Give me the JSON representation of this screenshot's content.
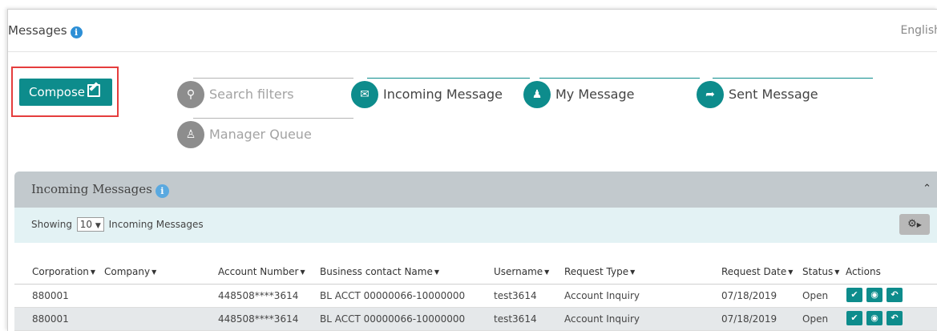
{
  "topbar": {
    "title": "Messages",
    "info_icon": "info-icon",
    "language": "English"
  },
  "compose": {
    "label": "Compose",
    "icon": "edit-icon"
  },
  "filters": {
    "search": {
      "label": "Search filters",
      "icon": "search-icon"
    },
    "incoming": {
      "label": "Incoming Message",
      "icon": "envelope-icon"
    },
    "my": {
      "label": "My Message",
      "icon": "user-arrow-icon"
    },
    "sent": {
      "label": "Sent Message",
      "icon": "share-icon"
    },
    "manager": {
      "label": "Manager Queue",
      "icon": "manager-icon"
    }
  },
  "panel": {
    "title": "Incoming Messages",
    "showing_prefix": "Showing",
    "page_size": "10",
    "showing_suffix": "Incoming Messages",
    "settings_icon": "gear-icon",
    "collapse_icon": "chevron-up-icon"
  },
  "table": {
    "columns": [
      "Corporation",
      "Company",
      "Account Number",
      "Business contact Name",
      "Username",
      "Request Type",
      "Request Date",
      "Status",
      "Actions"
    ],
    "rows": [
      {
        "corporation": "880001",
        "company": "",
        "account": "448508****3614",
        "contact": "BL ACCT 00000066-10000000",
        "username": "test3614",
        "request_type": "Account Inquiry",
        "date": "07/18/2019",
        "status": "Open"
      },
      {
        "corporation": "880001",
        "company": "",
        "account": "448508****3614",
        "contact": "BL ACCT 00000066-10000000",
        "username": "test3614",
        "request_type": "Account Inquiry",
        "date": "07/18/2019",
        "status": "Open"
      }
    ],
    "action_icons": [
      "check-icon",
      "eye-icon",
      "reply-icon"
    ]
  },
  "colors": {
    "accent": "#0d8c8c",
    "highlight": "#e53d3d",
    "panel_header": "#c2c9cd",
    "toolbar": "#e3f2f4",
    "info": "#2d8fd6"
  }
}
